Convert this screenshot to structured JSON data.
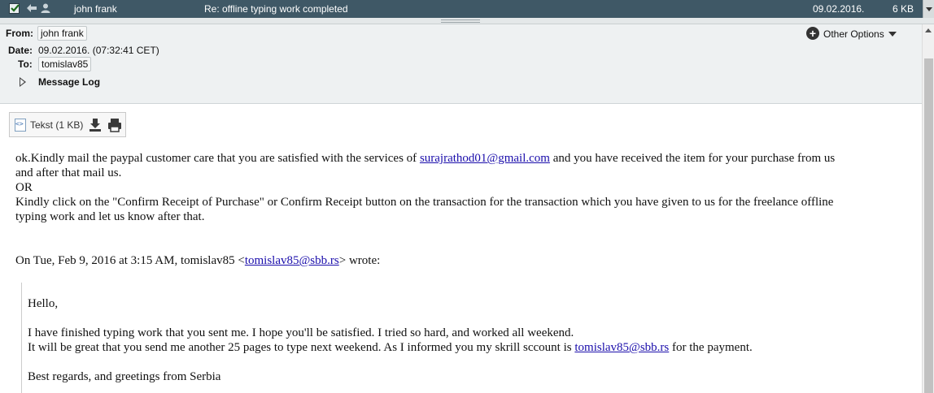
{
  "list_row": {
    "sender": "john frank",
    "subject": "Re: offline typing work completed",
    "date": "09.02.2016.",
    "size": "6 KB"
  },
  "header": {
    "from_label": "From:",
    "from_value": "john frank",
    "date_label": "Date:",
    "date_value": "09.02.2016. (07:32:41 CET)",
    "to_label": "To:",
    "to_value": "tomislav85",
    "message_log": "Message Log",
    "other_options": "Other Options"
  },
  "attachment": {
    "name": "Tekst (1 KB)"
  },
  "message": {
    "p1_a": "ok.Kindly mail the paypal customer care that you are satisfied with the services of ",
    "p1_link": "surajrathod01@gmail.com",
    "p1_b": " and you have received the item for your purchase from us",
    "p1_c": "and after that mail us.",
    "p2": "OR",
    "p3_a": "Kindly click on the \"Confirm Receipt of Purchase\" or Confirm Receipt button on the transaction for the transaction which you have given to us for the freelance offline",
    "p3_b": "typing work and let us know after that.",
    "reply_a": "On Tue, Feb 9, 2016 at 3:15 AM, tomislav85 <",
    "reply_link": "tomislav85@sbb.rs",
    "reply_b": "> wrote:"
  },
  "quote": {
    "greeting": "Hello,",
    "line1": "I have finished typing work that you sent me. I hope you'll be satisfied. I tried so hard, and worked all weekend.",
    "line2_a": "It will be great that you send me another 25 pages to type next weekend. As I informed you my skrill sccount is ",
    "line2_link": "tomislav85@sbb.rs",
    "line2_b": " for the payment.",
    "closing": "Best regards, and greetings from Serbia"
  },
  "colors": {
    "row_bar": "#3f5866",
    "header_bg": "#eef1f2",
    "link": "#1a0dab"
  }
}
